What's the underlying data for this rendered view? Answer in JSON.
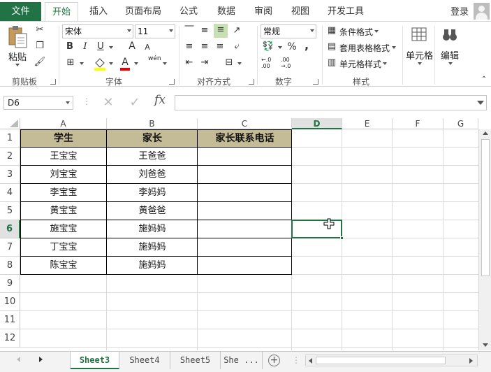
{
  "tabs": {
    "file": "文件",
    "home": "开始",
    "insert": "插入",
    "layout": "页面布局",
    "formula": "公式",
    "data": "数据",
    "review": "审阅",
    "view": "视图",
    "developer": "开发工具",
    "login": "登录"
  },
  "ribbon": {
    "clipboard": {
      "paste": "粘贴",
      "label": "剪贴板"
    },
    "font": {
      "name": "宋体",
      "size": "11",
      "bold": "B",
      "italic": "I",
      "underline": "U",
      "grow": "A",
      "shrink": "A",
      "fontcolor": "A",
      "wen": "wén",
      "label": "字体"
    },
    "align": {
      "label": "对齐方式"
    },
    "number": {
      "format": "常规",
      "percent": "%",
      "comma": ",",
      "inc": "←.0 .00",
      "dec": ".00 →.0",
      "label": "数字"
    },
    "styles": {
      "cond": "条件格式",
      "table": "套用表格格式",
      "cell": "单元格样式",
      "label": "样式"
    },
    "cells": {
      "label": "单元格"
    },
    "edit": {
      "label": "编辑"
    }
  },
  "formula_bar": {
    "name_box": "D6",
    "fx": "fx",
    "value": ""
  },
  "columns": [
    "A",
    "B",
    "C",
    "D",
    "E",
    "F",
    "G"
  ],
  "rows": [
    "1",
    "2",
    "3",
    "4",
    "5",
    "6",
    "7",
    "8",
    "9",
    "10",
    "11",
    "12"
  ],
  "table": {
    "header": [
      "学生",
      "家长",
      "家长联系电话"
    ],
    "rows": [
      [
        "王宝宝",
        "王爸爸",
        ""
      ],
      [
        "刘宝宝",
        "刘爸爸",
        ""
      ],
      [
        "李宝宝",
        "李妈妈",
        ""
      ],
      [
        "黄宝宝",
        "黄爸爸",
        ""
      ],
      [
        "施宝宝",
        "施妈妈",
        ""
      ],
      [
        "丁宝宝",
        "施妈妈",
        ""
      ],
      [
        "陈宝宝",
        "施妈妈",
        ""
      ]
    ]
  },
  "sheets": [
    "Sheet3",
    "Sheet4",
    "Sheet5",
    "She ..."
  ],
  "active_sheet": "Sheet3",
  "colors": {
    "accent": "#217346",
    "header_fill": "#c4bc96"
  }
}
